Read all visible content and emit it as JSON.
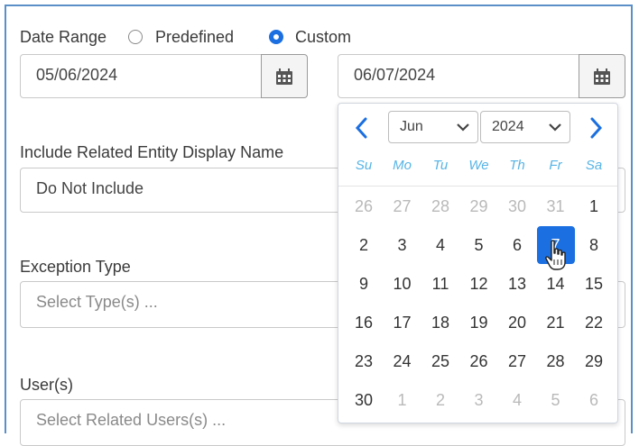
{
  "date_range": {
    "label": "Date Range",
    "option_predefined": "Predefined",
    "option_custom": "Custom",
    "selected": "Custom",
    "start_date": "05/06/2024",
    "end_date": "06/07/2024"
  },
  "related_entity": {
    "label": "Include Related Entity Display Name",
    "value": "Do Not Include"
  },
  "exception_type": {
    "label": "Exception Type",
    "placeholder": "Select Type(s) ..."
  },
  "users": {
    "label": "User(s)",
    "placeholder": "Select Related Users(s) ..."
  },
  "calendar": {
    "month": "Jun",
    "year": "2024",
    "weekdays": [
      "Su",
      "Mo",
      "Tu",
      "We",
      "Th",
      "Fr",
      "Sa"
    ],
    "weeks": [
      [
        {
          "d": "26",
          "m": true
        },
        {
          "d": "27",
          "m": true
        },
        {
          "d": "28",
          "m": true
        },
        {
          "d": "29",
          "m": true
        },
        {
          "d": "30",
          "m": true
        },
        {
          "d": "31",
          "m": true
        },
        {
          "d": "1"
        }
      ],
      [
        {
          "d": "2"
        },
        {
          "d": "3"
        },
        {
          "d": "4"
        },
        {
          "d": "5"
        },
        {
          "d": "6"
        },
        {
          "d": "7",
          "s": true
        },
        {
          "d": "8"
        }
      ],
      [
        {
          "d": "9"
        },
        {
          "d": "10"
        },
        {
          "d": "11"
        },
        {
          "d": "12"
        },
        {
          "d": "13"
        },
        {
          "d": "14"
        },
        {
          "d": "15"
        }
      ],
      [
        {
          "d": "16"
        },
        {
          "d": "17"
        },
        {
          "d": "18"
        },
        {
          "d": "19"
        },
        {
          "d": "20"
        },
        {
          "d": "21"
        },
        {
          "d": "22"
        }
      ],
      [
        {
          "d": "23"
        },
        {
          "d": "24"
        },
        {
          "d": "25"
        },
        {
          "d": "26"
        },
        {
          "d": "27"
        },
        {
          "d": "28"
        },
        {
          "d": "29"
        }
      ],
      [
        {
          "d": "30"
        },
        {
          "d": "1",
          "m": true
        },
        {
          "d": "2",
          "m": true
        },
        {
          "d": "3",
          "m": true
        },
        {
          "d": "4",
          "m": true
        },
        {
          "d": "5",
          "m": true
        },
        {
          "d": "6",
          "m": true
        }
      ]
    ],
    "selected_day": "7"
  },
  "colors": {
    "accent": "#1b6fe0",
    "weekday": "#56b4e6",
    "frame": "#5b8fc7"
  },
  "icons": {
    "calendar_button": "calendar-icon",
    "prev": "chevron-left-icon",
    "next": "chevron-right-icon",
    "cursor": "hand-pointer-icon"
  }
}
